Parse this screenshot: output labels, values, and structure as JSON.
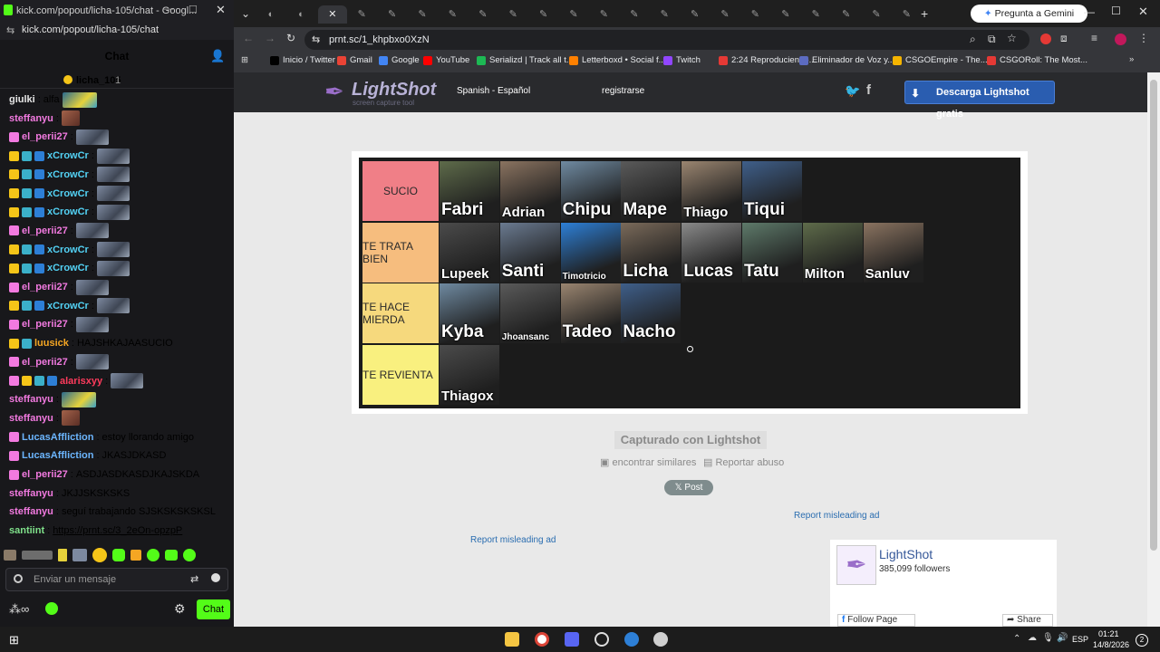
{
  "kick": {
    "window_title": "kick.com/popout/licha-105/chat - Googl...",
    "url": "kick.com/popout/licha-105/chat",
    "header": "Chat",
    "pinned_user": "licha_105",
    "pinned_count": "1",
    "messages": [
      {
        "user": "giulki",
        "color": "#e6e6e6",
        "text": "alfa",
        "emote": "y",
        "badges": []
      },
      {
        "user": "steffanyu",
        "color": "#f27ae0",
        "text": "",
        "emote": "r",
        "badges": []
      },
      {
        "user": "el_perii27",
        "color": "#f27ae0",
        "text": "",
        "emote": "g",
        "badges": [
          "#f27ae0"
        ]
      },
      {
        "user": "xCrowCr",
        "color": "#53d2f5",
        "text": "",
        "emote": "g",
        "badges": [
          "#f5c518",
          "#3bb0c9",
          "#2d7fd6"
        ]
      },
      {
        "user": "xCrowCr",
        "color": "#53d2f5",
        "text": "",
        "emote": "g",
        "badges": [
          "#f5c518",
          "#3bb0c9",
          "#2d7fd6"
        ]
      },
      {
        "user": "xCrowCr",
        "color": "#53d2f5",
        "text": "",
        "emote": "g",
        "badges": [
          "#f5c518",
          "#3bb0c9",
          "#2d7fd6"
        ]
      },
      {
        "user": "xCrowCr",
        "color": "#53d2f5",
        "text": "",
        "emote": "g",
        "badges": [
          "#f5c518",
          "#3bb0c9",
          "#2d7fd6"
        ]
      },
      {
        "user": "el_perii27",
        "color": "#f27ae0",
        "text": "",
        "emote": "g",
        "badges": [
          "#f27ae0"
        ]
      },
      {
        "user": "xCrowCr",
        "color": "#53d2f5",
        "text": "",
        "emote": "g",
        "badges": [
          "#f5c518",
          "#3bb0c9",
          "#2d7fd6"
        ]
      },
      {
        "user": "xCrowCr",
        "color": "#53d2f5",
        "text": "",
        "emote": "g",
        "badges": [
          "#f5c518",
          "#3bb0c9",
          "#2d7fd6"
        ]
      },
      {
        "user": "el_perii27",
        "color": "#f27ae0",
        "text": "",
        "emote": "g",
        "badges": [
          "#f27ae0"
        ]
      },
      {
        "user": "xCrowCr",
        "color": "#53d2f5",
        "text": "",
        "emote": "g",
        "badges": [
          "#f5c518",
          "#3bb0c9",
          "#2d7fd6"
        ]
      },
      {
        "user": "el_perii27",
        "color": "#f27ae0",
        "text": "",
        "emote": "g",
        "badges": [
          "#f27ae0"
        ]
      },
      {
        "user": "luusick",
        "color": "#f5a623",
        "text": "HAJSHKAJAASUCIO",
        "emote": "",
        "badges": [
          "#f5c518",
          "#3bb0c9"
        ]
      },
      {
        "user": "el_perii27",
        "color": "#f27ae0",
        "text": "",
        "emote": "g",
        "badges": [
          "#f27ae0"
        ]
      },
      {
        "user": "alarisxyy",
        "color": "#ff3b5c",
        "text": "",
        "emote": "g",
        "badges": [
          "#f27ae0",
          "#f5c518",
          "#3bb0c9",
          "#2d7fd6"
        ]
      },
      {
        "user": "steffanyu",
        "color": "#f27ae0",
        "text": "",
        "emote": "y",
        "badges": []
      },
      {
        "user": "steffanyu",
        "color": "#f27ae0",
        "text": "",
        "emote": "r",
        "badges": []
      },
      {
        "user": "LucasAffliction",
        "color": "#6cb6ff",
        "text": "estoy llorando amigo",
        "emote": "",
        "badges": [
          "#f27ae0"
        ]
      },
      {
        "user": "LucasAffliction",
        "color": "#6cb6ff",
        "text": "JKASJDKASD",
        "emote": "",
        "badges": [
          "#f27ae0"
        ]
      },
      {
        "user": "el_perii27",
        "color": "#f27ae0",
        "text": "ASDJASDKASDJKAJSKDA",
        "emote": "",
        "badges": [
          "#f27ae0"
        ]
      },
      {
        "user": "steffanyu",
        "color": "#f27ae0",
        "text": "JKJJSKSKSKS",
        "emote": "",
        "badges": []
      },
      {
        "user": "steffanyu",
        "color": "#f27ae0",
        "text": "seguí trabajando SJSKSKSKSKSL",
        "emote": "",
        "badges": []
      },
      {
        "user": "santiint",
        "color": "#7fe08a",
        "text": "https://prnt.sc/3_2eOn-opzpP",
        "emote": "",
        "badges": []
      }
    ],
    "input_placeholder": "Enviar un mensaje",
    "chat_button": "Chat"
  },
  "browser": {
    "url": "prnt.sc/1_khpbxo0XzN",
    "gemini_button": "Pregunta a Gemini",
    "bookmarks": [
      {
        "label": "Inicio / Twitter",
        "color": "#000000"
      },
      {
        "label": "Gmail",
        "color": "#ea4335"
      },
      {
        "label": "Google",
        "color": "#4285f4"
      },
      {
        "label": "YouTube",
        "color": "#ff0000"
      },
      {
        "label": "Serializd | Track all t...",
        "color": "#1db954"
      },
      {
        "label": "Letterboxd • Social f...",
        "color": "#ff8000"
      },
      {
        "label": "Twitch",
        "color": "#9146ff"
      },
      {
        "label": "2:24 Reproduciendo...",
        "color": "#e53935"
      },
      {
        "label": "Eliminador de Voz y...",
        "color": "#5c6bc0"
      },
      {
        "label": "CSGOEmpire - The...",
        "color": "#f5b400"
      },
      {
        "label": "CSGORoll: The Most...",
        "color": "#e53935"
      }
    ]
  },
  "lightshot": {
    "logo": "LightShot",
    "tagline": "screen capture tool",
    "language": "Spanish - Español",
    "register": "registrarse",
    "download": "Descarga Lightshot gratis",
    "captured": "Capturado con Lightshot",
    "similar": "encontrar similares",
    "report": "Reportar abuso",
    "post": "Post",
    "report_ad": "Report misleading ad",
    "report_ad2": "Report misleading ad",
    "fb_name": "LightShot",
    "fb_followers": "385,099 followers",
    "fb_follow": "Follow Page",
    "fb_share": "Share"
  },
  "tierlist": [
    {
      "label": "SUCIO",
      "color": "#f07f87",
      "items": [
        "Fabri",
        "Adrian",
        "Chipu",
        "Mape",
        "Thiago",
        "Tiqui"
      ]
    },
    {
      "label": "TE TRATA BIEN",
      "color": "#f6bd7e",
      "items": [
        "Lupeek",
        "Santi",
        "Timotricio",
        "Licha",
        "Lucas",
        "Tatu",
        "Milton",
        "Sanluv"
      ]
    },
    {
      "label": "TE HACE MIERDA",
      "color": "#f6d97d",
      "items": [
        "Kyba",
        "Jhoansanc",
        "Tadeo",
        "Nacho"
      ]
    },
    {
      "label": "TE REVIENTA",
      "color": "#f9f07f",
      "items": [
        "Thiagox"
      ]
    }
  ],
  "taskbar": {
    "lang": "ESP",
    "time": "01:21",
    "date": "14/8/2026",
    "notif": "2"
  }
}
